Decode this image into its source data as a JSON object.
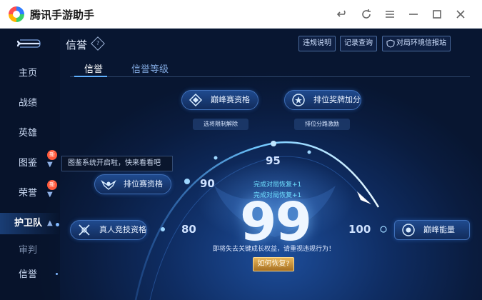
{
  "window": {
    "title": "腾讯手游助手",
    "controls": [
      "back-icon",
      "refresh-icon",
      "menu-icon",
      "minimize-icon",
      "maximize-icon",
      "close-icon"
    ]
  },
  "sidebar": {
    "items": [
      {
        "label": "主页"
      },
      {
        "label": "战绩"
      },
      {
        "label": "英雄"
      },
      {
        "label": "图鉴",
        "badge": "新"
      },
      {
        "label": "荣誉",
        "badge": "新"
      },
      {
        "label": "护卫队"
      },
      {
        "label": "审判"
      },
      {
        "label": "信誉"
      }
    ]
  },
  "header": {
    "title": "信誉",
    "help_label": "?",
    "buttons": [
      "违规说明",
      "记录查询",
      "对局环境信报站"
    ]
  },
  "tabs": [
    "信誉",
    "信誉等级"
  ],
  "tooltip": "图鉴系统开启啦，快来看看吧",
  "privileges": {
    "peak": {
      "label": "巅峰赛资格",
      "sub": "选将限制解除"
    },
    "rank_bonus": {
      "label": "排位奖牌加分",
      "sub": "排位分路激励"
    },
    "ranked": {
      "label": "排位赛资格"
    },
    "realperson": {
      "label": "真人竞技资格"
    },
    "peak_energy": {
      "label": "巅峰能量"
    }
  },
  "arc": {
    "markers": [
      "80",
      "90",
      "95",
      "100"
    ]
  },
  "score": {
    "value": "99",
    "recover_lines": [
      "完成对局恢复+1",
      "完成对局恢复+1"
    ],
    "warning": "即将失去关键成长权益，请重视违规行为！",
    "how_button": "如何恢复?"
  }
}
